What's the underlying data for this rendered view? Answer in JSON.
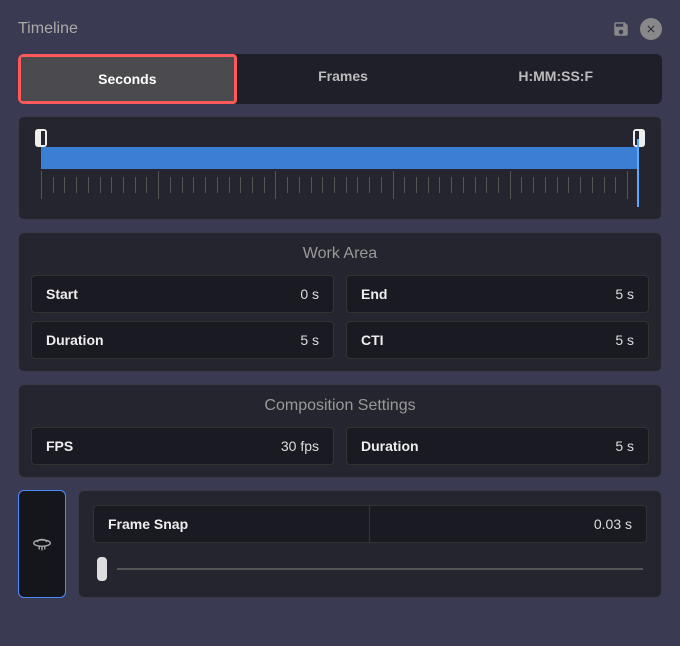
{
  "header": {
    "title": "Timeline"
  },
  "tabs": {
    "seconds": "Seconds",
    "frames": "Frames",
    "timecode": "H:MM:SS:F"
  },
  "workArea": {
    "title": "Work Area",
    "start": {
      "label": "Start",
      "value": "0 s"
    },
    "end": {
      "label": "End",
      "value": "5 s"
    },
    "duration": {
      "label": "Duration",
      "value": "5 s"
    },
    "cti": {
      "label": "CTI",
      "value": "5 s"
    }
  },
  "composition": {
    "title": "Composition Settings",
    "fps": {
      "label": "FPS",
      "value": "30 fps"
    },
    "duration": {
      "label": "Duration",
      "value": "5 s"
    }
  },
  "frameSnap": {
    "label": "Frame Snap",
    "value": "0.03 s"
  }
}
